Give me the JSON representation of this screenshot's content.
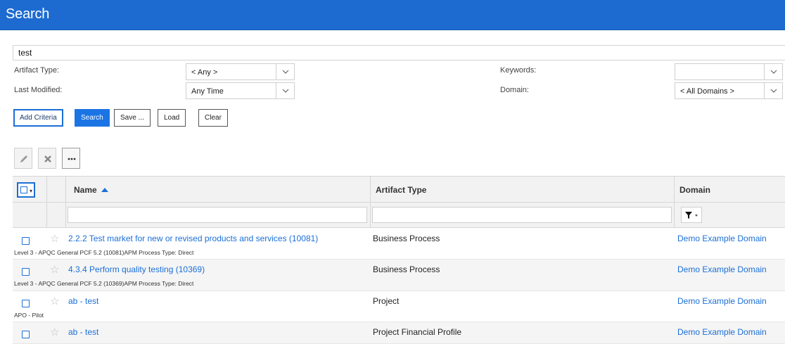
{
  "header": {
    "title": "Search"
  },
  "search": {
    "query": "test"
  },
  "criteria": {
    "artifact_type_label": "Artifact Type:",
    "artifact_type_value": "< Any >",
    "last_modified_label": "Last Modified:",
    "last_modified_value": "Any Time",
    "keywords_label": "Keywords:",
    "keywords_value": "",
    "domain_label": "Domain:",
    "domain_value": "< All Domains >"
  },
  "buttons": {
    "add_criteria": "Add Criteria",
    "search": "Search",
    "save": "Save ...",
    "load": "Load",
    "clear": "Clear"
  },
  "toolbar": {
    "icons": [
      "pencil-icon",
      "x-icon",
      "more-icon"
    ]
  },
  "table": {
    "columns": {
      "name": "Name",
      "artifact_type": "Artifact Type",
      "domain": "Domain"
    },
    "sort": {
      "column": "Name",
      "direction": "ascending"
    },
    "rows": [
      {
        "name": "2.2.2 Test market for new or revised products and services (10081)",
        "artifact_type": "Business Process",
        "domain": "Demo Example Domain",
        "description": "Level 3 - APQC General PCF 5.2 (10081)APM Process Type: Direct"
      },
      {
        "name": "4.3.4 Perform quality testing (10369)",
        "artifact_type": "Business Process",
        "domain": "Demo Example Domain",
        "description": "Level 3 - APQC General PCF 5.2 (10369)APM Process Type: Direct"
      },
      {
        "name": "ab - test",
        "artifact_type": "Project",
        "domain": "Demo Example Domain",
        "description": "APO - Pilot"
      },
      {
        "name": "ab - test",
        "artifact_type": "Project Financial Profile",
        "domain": "Demo Example Domain",
        "description": ""
      }
    ]
  },
  "colors": {
    "header_bg": "#1d6bd0",
    "link": "#1b6fd6",
    "primary_button": "#1b74e4"
  }
}
